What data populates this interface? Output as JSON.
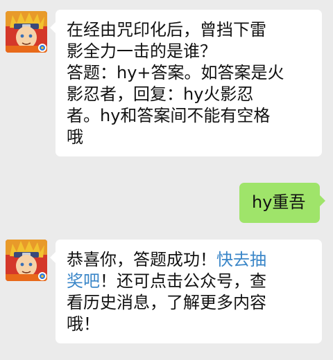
{
  "colors": {
    "background": "#ebebeb",
    "incoming_bubble": "#ffffff",
    "outgoing_bubble": "#9fe46a",
    "link": "#3a86c8"
  },
  "messages": [
    {
      "sender": "bot",
      "avatar_icon": "naruto-avatar-icon",
      "lines": [
        "在经由咒印化后，曾挡下雷",
        "影全力一击的是谁？",
        "答题：hy+答案。如答案是火",
        "影忍者，回复：hy火影忍",
        "者。hy和答案间不能有空格",
        "哦"
      ]
    },
    {
      "sender": "user",
      "text": "hy重吾"
    },
    {
      "sender": "bot",
      "avatar_icon": "naruto-avatar-icon",
      "line1_text": "恭喜你，答题成功！",
      "line1_link": "快去抽",
      "line2_link": "奖吧",
      "line2_text": "！还可点击公众号，查",
      "line3": "看历史消息，了解更多内容",
      "line4": "哦！"
    }
  ]
}
